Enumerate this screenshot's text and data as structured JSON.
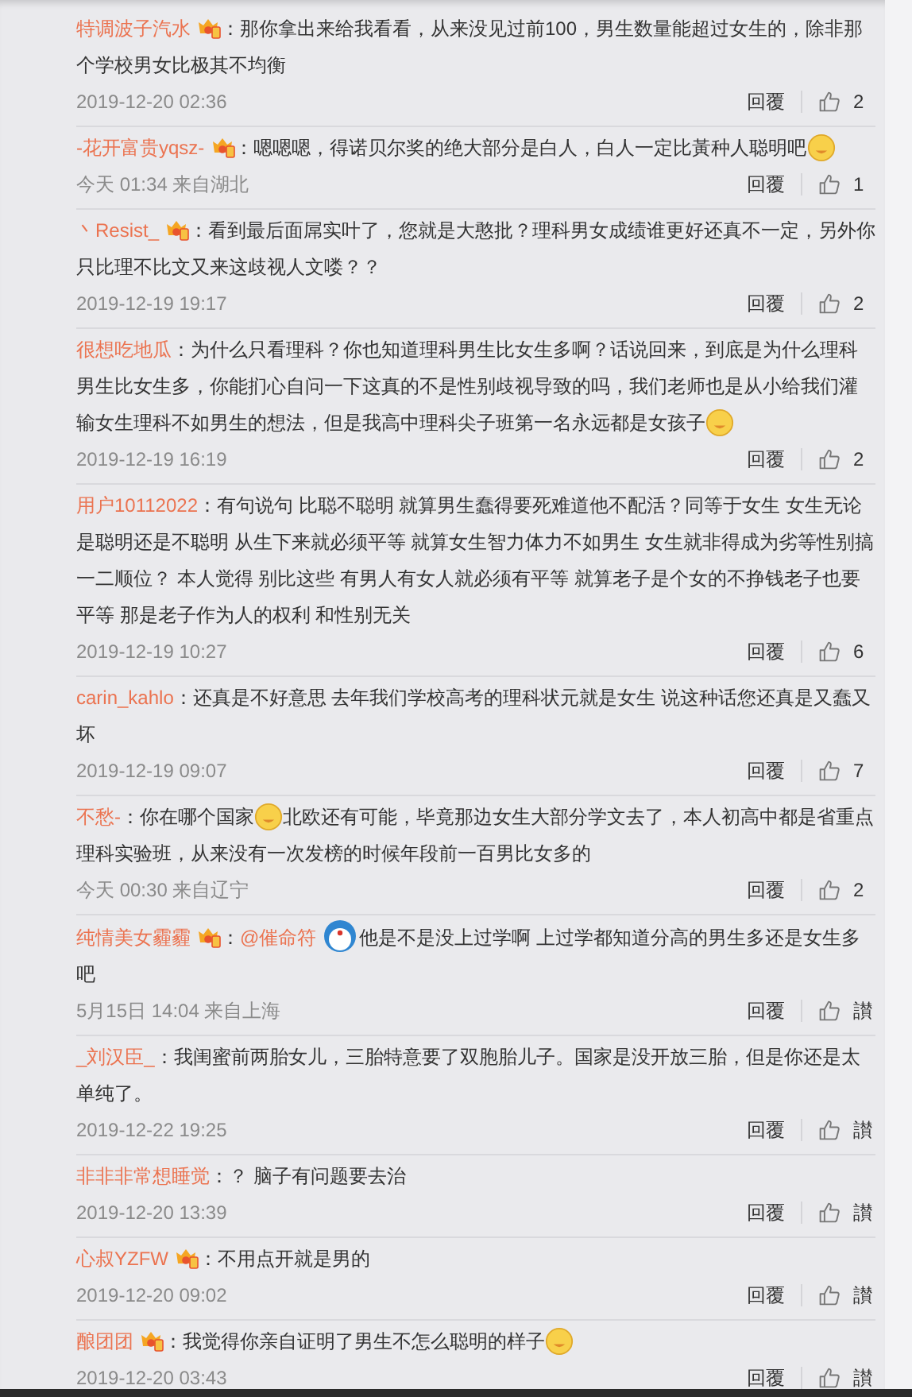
{
  "comments": [
    {
      "name": "特调波子汽水",
      "vip": true,
      "separator": "：",
      "content": [
        {
          "kind": "text",
          "text": "那你拿出来给我看看，从来没见过前100，男生数量能超过女生的，除非那个学校男女比极其不均衡"
        }
      ],
      "time": "2019-12-20 02:36",
      "reply": "回覆",
      "likes": "2"
    },
    {
      "name": "-花开富贵yqsz-",
      "vip": true,
      "separator": "：",
      "content": [
        {
          "kind": "text",
          "text": "嗯嗯嗯，得诺贝尔奖的绝大部分是白人，白人一定比黃种人聪明吧"
        },
        {
          "kind": "emoji"
        }
      ],
      "time": "今天 01:34 来自湖北",
      "reply": "回覆",
      "likes": "1"
    },
    {
      "name": "丶Resist_",
      "vip": true,
      "separator": "：",
      "content": [
        {
          "kind": "text",
          "text": "看到最后面屌实叶了，您就是大憨批？理科男女成绩谁更好还真不一定，另外你只比理不比文又来这歧视人文喽？？"
        }
      ],
      "time": "2019-12-19 19:17",
      "reply": "回覆",
      "likes": "2"
    },
    {
      "name": "很想吃地瓜",
      "vip": false,
      "separator": "：",
      "content": [
        {
          "kind": "text",
          "text": "为什么只看理科？你也知道理科男生比女生多啊？话说回来，到底是为什么理科男生比女生多，你能扪心自问一下这真的不是性别歧视导致的吗，我们老师也是从小给我们灌输女生理科不如男生的想法，但是我高中理科尖子班第一名永远都是女孩子"
        },
        {
          "kind": "emoji"
        }
      ],
      "time": "2019-12-19 16:19",
      "reply": "回覆",
      "likes": "2"
    },
    {
      "name": "用户10112022",
      "vip": false,
      "separator": "：",
      "content": [
        {
          "kind": "text",
          "text": "有句说句 比聪不聪明 就算男生蠢得要死难道他不配活？同等于女生 女生无论是聪明还是不聪明 从生下来就必须平等 就算女生智力体力不如男生 女生就非得成为劣等性别搞一二顺位？ 本人觉得 别比这些 有男人有女人就必须有平等 就算老子是个女的不挣钱老子也要平等 那是老子作为人的权利 和性别无关"
        }
      ],
      "time": "2019-12-19 10:27",
      "reply": "回覆",
      "likes": "6"
    },
    {
      "name": "carin_kahlo",
      "vip": false,
      "separator": "：",
      "content": [
        {
          "kind": "text",
          "text": "还真是不好意思 去年我们学校高考的理科状元就是女生 说这种话您还真是又蠢又坏"
        }
      ],
      "time": "2019-12-19 09:07",
      "reply": "回覆",
      "likes": "7"
    },
    {
      "name": "不愁-",
      "vip": false,
      "separator": "：",
      "content": [
        {
          "kind": "text",
          "text": "你在哪个国家"
        },
        {
          "kind": "emoji"
        },
        {
          "kind": "text",
          "text": "北欧还有可能，毕竟那边女生大部分学文去了，本人初高中都是省重点理科实验班，从来没有一次发榜的时候年段前一百男比女多的"
        }
      ],
      "time": "今天 00:30 来自辽宁",
      "reply": "回覆",
      "likes": "2"
    },
    {
      "name": "纯情美女霾霾",
      "vip": true,
      "separator": "：",
      "content": [
        {
          "kind": "mention",
          "text": "@催命符"
        },
        {
          "kind": "sticker"
        },
        {
          "kind": "text",
          "text": "他是不是没上过学啊 上过学都知道分高的男生多还是女生多吧"
        }
      ],
      "time": "5月15日 14:04 来自上海",
      "reply": "回覆",
      "likes": "讃"
    },
    {
      "name": "_刘汉臣_",
      "vip": false,
      "separator": "：",
      "content": [
        {
          "kind": "text",
          "text": "我闺蜜前两胎女儿，三胎特意要了双胞胎儿子。国家是没开放三胎，但是你还是太单纯了。"
        }
      ],
      "time": "2019-12-22 19:25",
      "reply": "回覆",
      "likes": "讃"
    },
    {
      "name": "非非非常想睡觉",
      "vip": false,
      "separator": "：",
      "content": [
        {
          "kind": "text",
          "text": "？ 脑子有问题要去治"
        }
      ],
      "time": "2019-12-20 13:39",
      "reply": "回覆",
      "likes": "讃"
    },
    {
      "name": "心叔YZFW",
      "vip": true,
      "separator": "：",
      "content": [
        {
          "kind": "text",
          "text": "不用点开就是男的"
        }
      ],
      "time": "2019-12-20 09:02",
      "reply": "回覆",
      "likes": "讃"
    },
    {
      "name": "酿团团",
      "vip": true,
      "separator": "：",
      "content": [
        {
          "kind": "text",
          "text": "我觉得你亲自证明了男生不怎么聪明的样子"
        },
        {
          "kind": "emoji"
        }
      ],
      "time": "2019-12-20 03:43",
      "reply": "回覆",
      "likes": "讃"
    }
  ]
}
